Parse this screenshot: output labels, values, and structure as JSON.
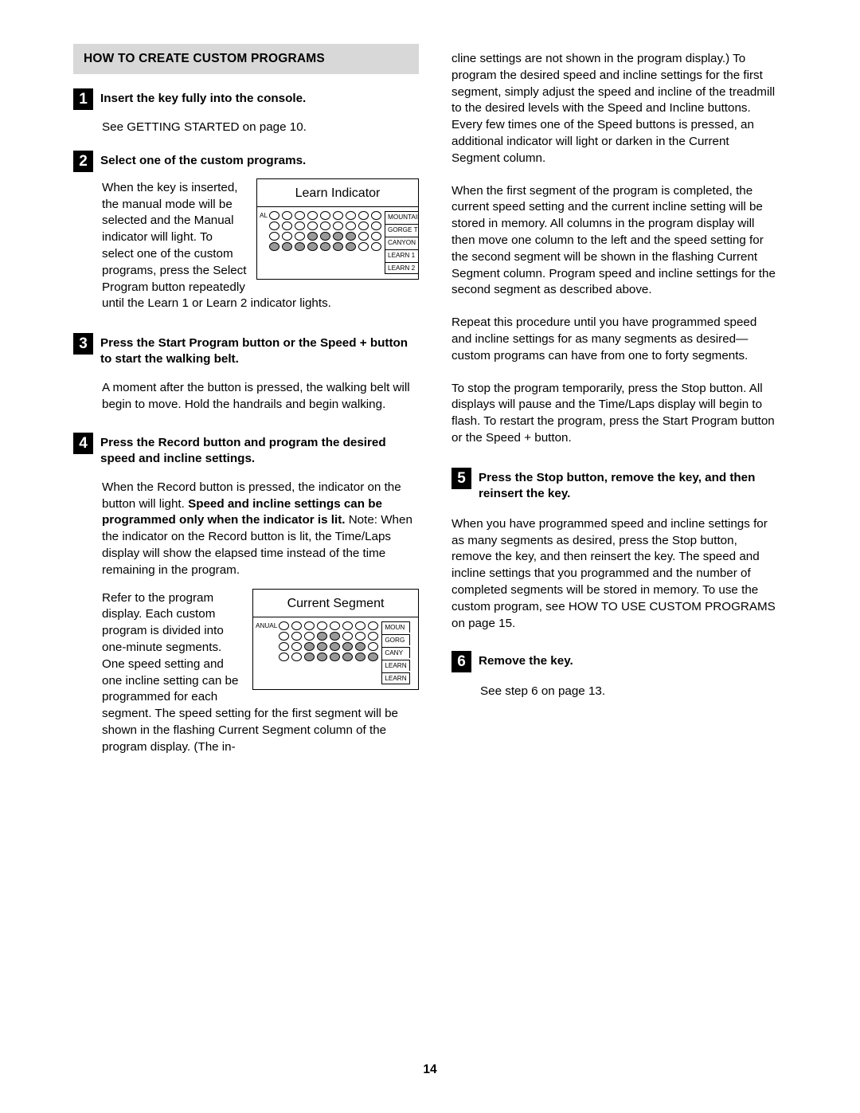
{
  "document": {
    "section_title": "HOW TO CREATE CUSTOM PROGRAMS",
    "page_number": "14"
  },
  "left_column": {
    "steps": [
      {
        "number": "1",
        "heading": "Insert the key fully into the console.",
        "body": "See GETTING STARTED on page 10."
      },
      {
        "number": "2",
        "heading": "Select one of the custom programs.",
        "body_wrap": "When the key is inserted, the manual mode will be selected and the Manual indicator will light. To select one of the custom programs, press the Select Program button repeatedly until the Learn 1 or Learn 2 indicator lights."
      },
      {
        "number": "3",
        "heading": "Press the Start Program button or the Speed + button to start the walking belt.",
        "body": "A moment after the button is pressed, the walking belt will begin to move. Hold the handrails and begin walking."
      },
      {
        "number": "4",
        "heading": "Press the Record button and program the desired speed and incline settings.",
        "body_part1": "When the Record button is pressed, the indicator on the button will light. ",
        "body_bold": "Speed and incline settings can be programmed only when the indicator is lit.",
        "body_part2": " Note: When the indicator on the Record button is lit, the Time/Laps display will show the elapsed time instead of the time remaining in the program.",
        "body_wrap2": "Refer to the program display. Each custom program is divided into one-minute segments. One speed setting and one incline setting can be programmed for each segment. The speed setting for the first segment will be shown in the flashing Current Segment column of the program display. (The in-"
      }
    ],
    "figures": {
      "learn_indicator": {
        "caption": "Learn Indicator",
        "left_label": "AL",
        "right_labels": [
          "MOUNTAIN",
          "GORGE TR",
          "CANYON R",
          "LEARN 1",
          "LEARN 2"
        ]
      },
      "current_segment": {
        "caption": "Current Segment",
        "left_label": "ANUAL",
        "right_labels": [
          "MOUN",
          "GORG",
          "CANY",
          "LEARN",
          "LEARN"
        ]
      }
    }
  },
  "right_column": {
    "paragraphs": [
      "cline settings are not shown in the program display.) To program the desired speed and incline settings for the first segment, simply adjust the speed and incline of the treadmill to the desired levels with the Speed and Incline buttons. Every few times one of the Speed buttons is pressed, an additional indicator will light or darken in the Current Segment column.",
      "When the first segment of the program is completed, the current speed setting and the current incline setting will be stored in memory. All columns in the program display will then move one column to the left and the speed setting for the second segment will be shown in the flashing Current Segment column. Program speed and incline settings for the second segment as described above.",
      "Repeat this procedure until you have programmed speed and incline settings for as many segments as desired—custom programs can have from one to forty segments.",
      "To stop the program temporarily, press the Stop button. All displays will pause and the Time/Laps display will begin to flash. To restart the program, press the Start Program button or the Speed + button."
    ],
    "steps": [
      {
        "number": "5",
        "heading": "Press the Stop button, remove the key, and then reinsert the key.",
        "body": "When you have programmed speed and incline settings for as many segments as desired, press the Stop button, remove the key, and then reinsert the key. The speed and incline settings that you programmed and the number of completed segments will be stored in memory. To use the custom program, see HOW TO USE CUSTOM PROGRAMS on page 15."
      },
      {
        "number": "6",
        "heading": "Remove the key.",
        "body": "See step 6 on page 13."
      }
    ]
  }
}
